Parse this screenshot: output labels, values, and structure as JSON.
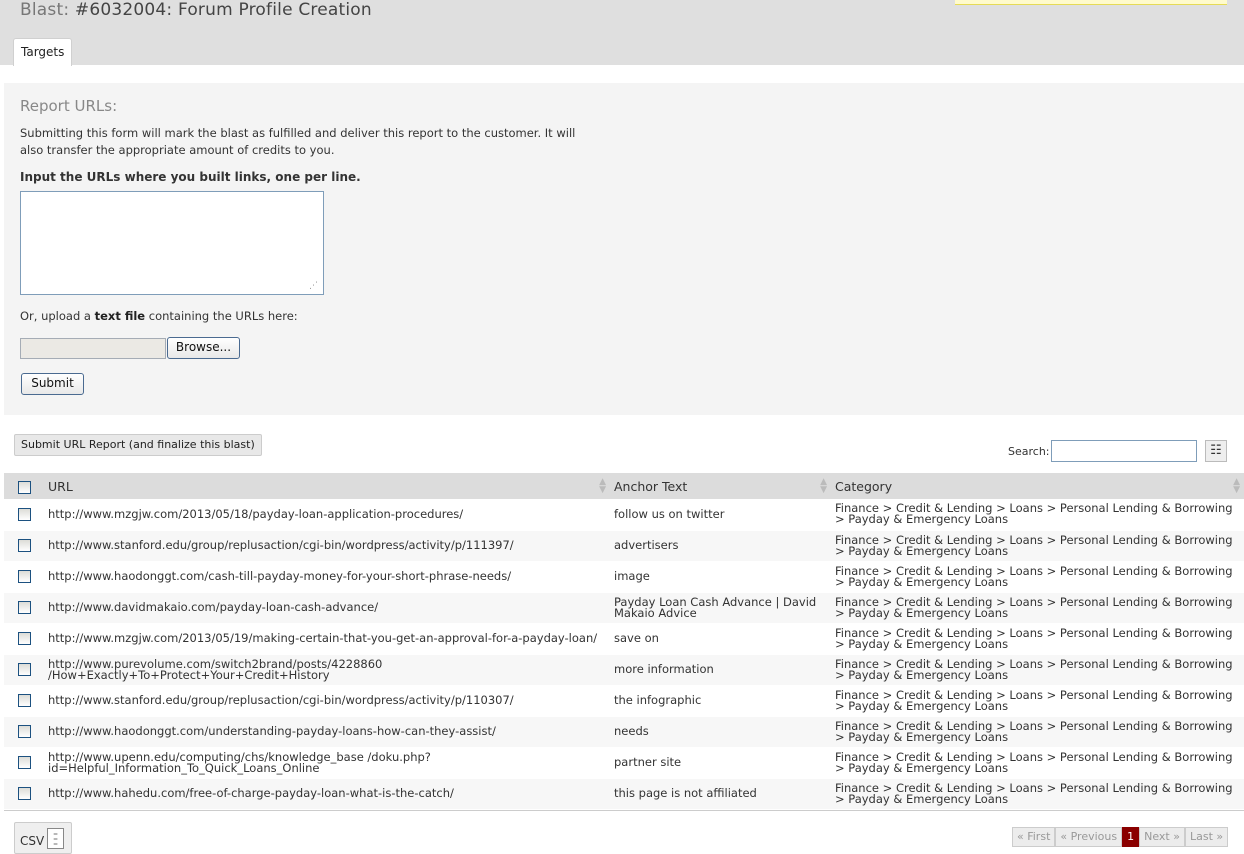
{
  "header": {
    "title_label": "Blast:",
    "title_text": "#6032004: Forum Profile Creation",
    "tab_label": "Targets"
  },
  "form": {
    "heading": "Report URLs:",
    "description": "Submitting this form will mark the blast as fulfilled and deliver this report to the customer. It will also transfer the appropriate amount of credits to you.",
    "input_label": "Input the URLs where you built links, one per line.",
    "textarea_value": "",
    "upload_prefix": "Or, upload a",
    "upload_bold": "text file",
    "upload_suffix": "containing the URLs here:",
    "browse_label": "Browse...",
    "submit_label": "Submit"
  },
  "toolbar": {
    "finalize_label": "Submit URL Report (and finalize this blast)",
    "search_label": "Search:",
    "search_value": ""
  },
  "table": {
    "columns": [
      "URL",
      "Anchor Text",
      "Category"
    ],
    "rows": [
      {
        "url": "http://www.mzgjw.com/2013/05/18/payday-loan-application-procedures/",
        "anchor": "follow us on twitter",
        "category": "Finance > Credit & Lending > Loans > Personal Lending & Borrowing > Payday & Emergency Loans"
      },
      {
        "url": "http://www.stanford.edu/group/replusaction/cgi-bin/wordpress/activity/p/111397/",
        "anchor": "advertisers",
        "category": "Finance > Credit & Lending > Loans > Personal Lending & Borrowing > Payday & Emergency Loans"
      },
      {
        "url": "http://www.haodonggt.com/cash-till-payday-money-for-your-short-phrase-needs/",
        "anchor": "image",
        "category": "Finance > Credit & Lending > Loans > Personal Lending & Borrowing > Payday & Emergency Loans"
      },
      {
        "url": "http://www.davidmakaio.com/payday-loan-cash-advance/",
        "anchor": "Payday Loan Cash Advance | David Makaio Advice",
        "category": "Finance > Credit & Lending > Loans > Personal Lending & Borrowing > Payday & Emergency Loans"
      },
      {
        "url": "http://www.mzgjw.com/2013/05/19/making-certain-that-you-get-an-approval-for-a-payday-loan/",
        "anchor": "save on",
        "category": "Finance > Credit & Lending > Loans > Personal Lending & Borrowing > Payday & Emergency Loans"
      },
      {
        "url": "http://www.purevolume.com/switch2brand/posts/4228860 /How+Exactly+To+Protect+Your+Credit+History",
        "anchor": "more information",
        "category": "Finance > Credit & Lending > Loans > Personal Lending & Borrowing > Payday & Emergency Loans"
      },
      {
        "url": "http://www.stanford.edu/group/replusaction/cgi-bin/wordpress/activity/p/110307/",
        "anchor": "the infographic",
        "category": "Finance > Credit & Lending > Loans > Personal Lending & Borrowing > Payday & Emergency Loans"
      },
      {
        "url": "http://www.haodonggt.com/understanding-payday-loans-how-can-they-assist/",
        "anchor": "needs",
        "category": "Finance > Credit & Lending > Loans > Personal Lending & Borrowing > Payday & Emergency Loans"
      },
      {
        "url": "http://www.upenn.edu/computing/chs/knowledge_base /doku.php?id=Helpful_Information_To_Quick_Loans_Online",
        "anchor": "partner site",
        "category": "Finance > Credit & Lending > Loans > Personal Lending & Borrowing > Payday & Emergency Loans"
      },
      {
        "url": "http://www.hahedu.com/free-of-charge-payday-loan-what-is-the-catch/",
        "anchor": "this page is not affiliated",
        "category": "Finance > Credit & Lending > Loans > Personal Lending & Borrowing > Payday & Emergency Loans"
      }
    ]
  },
  "footer": {
    "csv_label": "CSV",
    "pager": {
      "first": "« First",
      "previous": "« Previous",
      "current": "1",
      "next": "Next »",
      "last": "Last »"
    }
  },
  "icons": {
    "sort": "sort-arrows-icon",
    "columns": "columns-icon",
    "csv": "document-icon"
  },
  "colors": {
    "active_page": "#8a0000",
    "header_bg": "#dfdfdf"
  }
}
